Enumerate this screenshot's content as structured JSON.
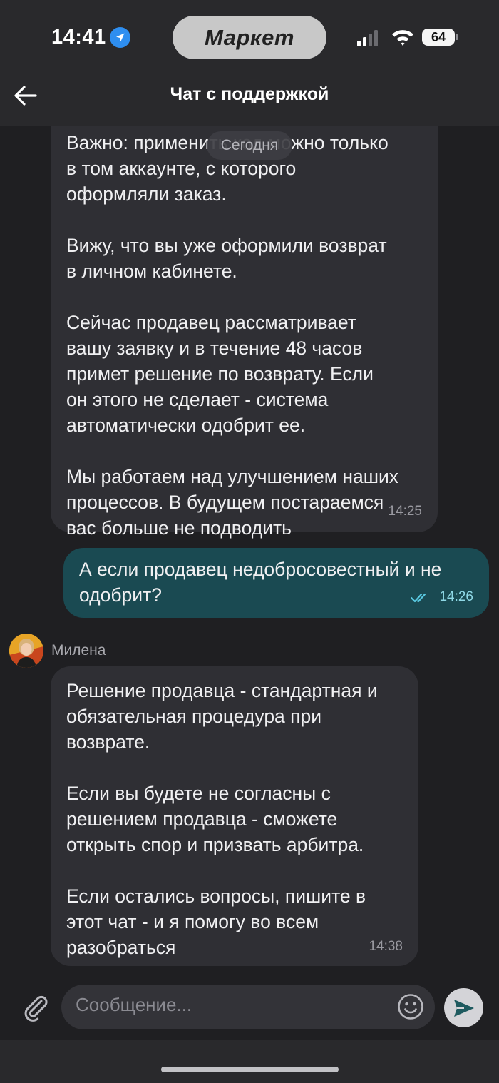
{
  "status_bar": {
    "time": "14:41",
    "island_label": "Маркет",
    "battery": "64",
    "icons": [
      "location-arrow-icon",
      "cellular-signal-icon",
      "wifi-icon",
      "battery-icon"
    ]
  },
  "header": {
    "title": "Чат с поддержкой",
    "back_icon": "arrow-left-icon"
  },
  "chat": {
    "date_divider": "Сегодня",
    "messages": [
      {
        "side": "incoming",
        "text": "Важно: применить код можно только\nв том аккаунте, с которого\nоформляли заказ.\n\nВижу, что вы уже оформили возврат\nв личном кабинете.\n\nСейчас продавец рассматривает\nвашу заявку и в течение 48 часов\nпримет решение по возврату. Если\nон этого не сделает - система\nавтоматически одобрит ее.\n\nМы работаем над улучшением наших\nпроцессов. В будущем постараемся\nвас больше не подводить",
        "time": "14:25"
      },
      {
        "side": "outgoing",
        "text": "А если продавец недобросовестный и не\nодобрит?",
        "time": "14:26",
        "status": "read"
      },
      {
        "side": "incoming",
        "sender": "Милена",
        "text": "Решение продавца - стандартная и\nобязательная процедура при\nвозврате.\n\nЕсли вы будете не согласны с\nрешением продавца - сможете\nоткрыть спор и призвать арбитра.\n\nЕсли остались вопросы, пишите в\nэтот чат - и я помогу во всем\nразобраться",
        "time": "14:38"
      }
    ]
  },
  "composer": {
    "placeholder": "Сообщение...",
    "attach_icon": "paperclip-icon",
    "emoji_icon": "smiley-icon",
    "send_icon": "send-arrow-icon"
  },
  "colors": {
    "background": "#1f1f22",
    "header": "#29292c",
    "incoming_bubble": "#2f2f34",
    "outgoing_bubble": "#1a4a52",
    "read_check": "#59c8e0"
  }
}
